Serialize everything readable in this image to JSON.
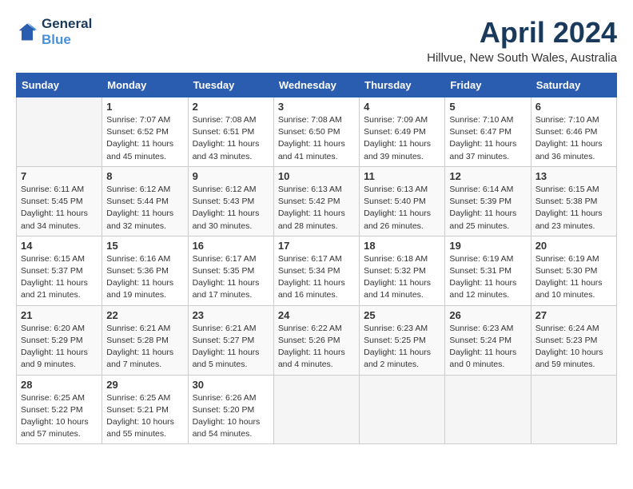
{
  "header": {
    "logo_line1": "General",
    "logo_line2": "Blue",
    "month_title": "April 2024",
    "location": "Hillvue, New South Wales, Australia"
  },
  "weekdays": [
    "Sunday",
    "Monday",
    "Tuesday",
    "Wednesday",
    "Thursday",
    "Friday",
    "Saturday"
  ],
  "weeks": [
    [
      {
        "day": "",
        "info": ""
      },
      {
        "day": "1",
        "info": "Sunrise: 7:07 AM\nSunset: 6:52 PM\nDaylight: 11 hours\nand 45 minutes."
      },
      {
        "day": "2",
        "info": "Sunrise: 7:08 AM\nSunset: 6:51 PM\nDaylight: 11 hours\nand 43 minutes."
      },
      {
        "day": "3",
        "info": "Sunrise: 7:08 AM\nSunset: 6:50 PM\nDaylight: 11 hours\nand 41 minutes."
      },
      {
        "day": "4",
        "info": "Sunrise: 7:09 AM\nSunset: 6:49 PM\nDaylight: 11 hours\nand 39 minutes."
      },
      {
        "day": "5",
        "info": "Sunrise: 7:10 AM\nSunset: 6:47 PM\nDaylight: 11 hours\nand 37 minutes."
      },
      {
        "day": "6",
        "info": "Sunrise: 7:10 AM\nSunset: 6:46 PM\nDaylight: 11 hours\nand 36 minutes."
      }
    ],
    [
      {
        "day": "7",
        "info": "Sunrise: 6:11 AM\nSunset: 5:45 PM\nDaylight: 11 hours\nand 34 minutes."
      },
      {
        "day": "8",
        "info": "Sunrise: 6:12 AM\nSunset: 5:44 PM\nDaylight: 11 hours\nand 32 minutes."
      },
      {
        "day": "9",
        "info": "Sunrise: 6:12 AM\nSunset: 5:43 PM\nDaylight: 11 hours\nand 30 minutes."
      },
      {
        "day": "10",
        "info": "Sunrise: 6:13 AM\nSunset: 5:42 PM\nDaylight: 11 hours\nand 28 minutes."
      },
      {
        "day": "11",
        "info": "Sunrise: 6:13 AM\nSunset: 5:40 PM\nDaylight: 11 hours\nand 26 minutes."
      },
      {
        "day": "12",
        "info": "Sunrise: 6:14 AM\nSunset: 5:39 PM\nDaylight: 11 hours\nand 25 minutes."
      },
      {
        "day": "13",
        "info": "Sunrise: 6:15 AM\nSunset: 5:38 PM\nDaylight: 11 hours\nand 23 minutes."
      }
    ],
    [
      {
        "day": "14",
        "info": "Sunrise: 6:15 AM\nSunset: 5:37 PM\nDaylight: 11 hours\nand 21 minutes."
      },
      {
        "day": "15",
        "info": "Sunrise: 6:16 AM\nSunset: 5:36 PM\nDaylight: 11 hours\nand 19 minutes."
      },
      {
        "day": "16",
        "info": "Sunrise: 6:17 AM\nSunset: 5:35 PM\nDaylight: 11 hours\nand 17 minutes."
      },
      {
        "day": "17",
        "info": "Sunrise: 6:17 AM\nSunset: 5:34 PM\nDaylight: 11 hours\nand 16 minutes."
      },
      {
        "day": "18",
        "info": "Sunrise: 6:18 AM\nSunset: 5:32 PM\nDaylight: 11 hours\nand 14 minutes."
      },
      {
        "day": "19",
        "info": "Sunrise: 6:19 AM\nSunset: 5:31 PM\nDaylight: 11 hours\nand 12 minutes."
      },
      {
        "day": "20",
        "info": "Sunrise: 6:19 AM\nSunset: 5:30 PM\nDaylight: 11 hours\nand 10 minutes."
      }
    ],
    [
      {
        "day": "21",
        "info": "Sunrise: 6:20 AM\nSunset: 5:29 PM\nDaylight: 11 hours\nand 9 minutes."
      },
      {
        "day": "22",
        "info": "Sunrise: 6:21 AM\nSunset: 5:28 PM\nDaylight: 11 hours\nand 7 minutes."
      },
      {
        "day": "23",
        "info": "Sunrise: 6:21 AM\nSunset: 5:27 PM\nDaylight: 11 hours\nand 5 minutes."
      },
      {
        "day": "24",
        "info": "Sunrise: 6:22 AM\nSunset: 5:26 PM\nDaylight: 11 hours\nand 4 minutes."
      },
      {
        "day": "25",
        "info": "Sunrise: 6:23 AM\nSunset: 5:25 PM\nDaylight: 11 hours\nand 2 minutes."
      },
      {
        "day": "26",
        "info": "Sunrise: 6:23 AM\nSunset: 5:24 PM\nDaylight: 11 hours\nand 0 minutes."
      },
      {
        "day": "27",
        "info": "Sunrise: 6:24 AM\nSunset: 5:23 PM\nDaylight: 10 hours\nand 59 minutes."
      }
    ],
    [
      {
        "day": "28",
        "info": "Sunrise: 6:25 AM\nSunset: 5:22 PM\nDaylight: 10 hours\nand 57 minutes."
      },
      {
        "day": "29",
        "info": "Sunrise: 6:25 AM\nSunset: 5:21 PM\nDaylight: 10 hours\nand 55 minutes."
      },
      {
        "day": "30",
        "info": "Sunrise: 6:26 AM\nSunset: 5:20 PM\nDaylight: 10 hours\nand 54 minutes."
      },
      {
        "day": "",
        "info": ""
      },
      {
        "day": "",
        "info": ""
      },
      {
        "day": "",
        "info": ""
      },
      {
        "day": "",
        "info": ""
      }
    ]
  ]
}
